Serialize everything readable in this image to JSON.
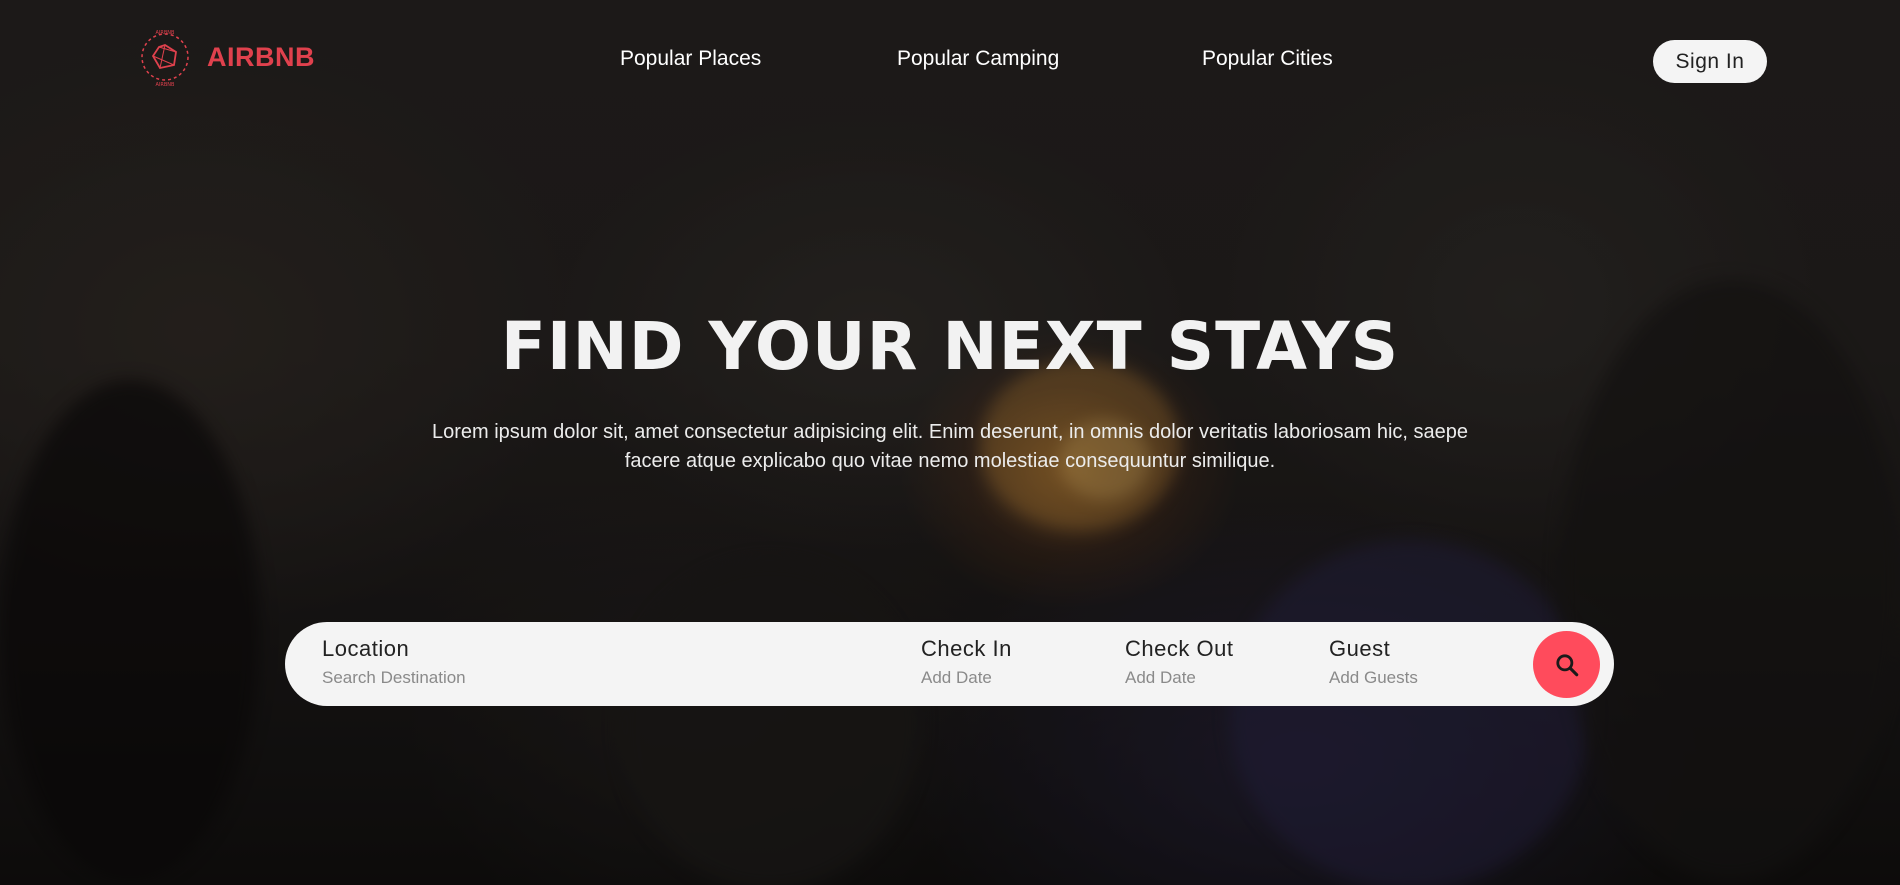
{
  "brand": {
    "name": "AIRBNB",
    "ring_text": "AIRBNB",
    "accent_color": "#e0414d"
  },
  "nav": {
    "links": [
      {
        "label": "Popular Places"
      },
      {
        "label": "Popular Camping"
      },
      {
        "label": "Popular Cities"
      }
    ],
    "signin_label": "Sign In"
  },
  "hero": {
    "headline": "FIND YOUR NEXT STAYS",
    "subtext": "Lorem ipsum dolor sit, amet consectetur adipisicing elit. Enim deserunt, in omnis dolor veritatis laboriosam hic, saepe facere atque explicabo quo vitae nemo molestiae consequuntur similique."
  },
  "search": {
    "fields": [
      {
        "label": "Location",
        "hint": "Search Destination"
      },
      {
        "label": "Check In",
        "hint": "Add Date"
      },
      {
        "label": "Check Out",
        "hint": "Add Date"
      },
      {
        "label": "Guest",
        "hint": "Add Guests"
      }
    ],
    "button_icon": "search-icon",
    "button_color": "#ff4b5c"
  }
}
